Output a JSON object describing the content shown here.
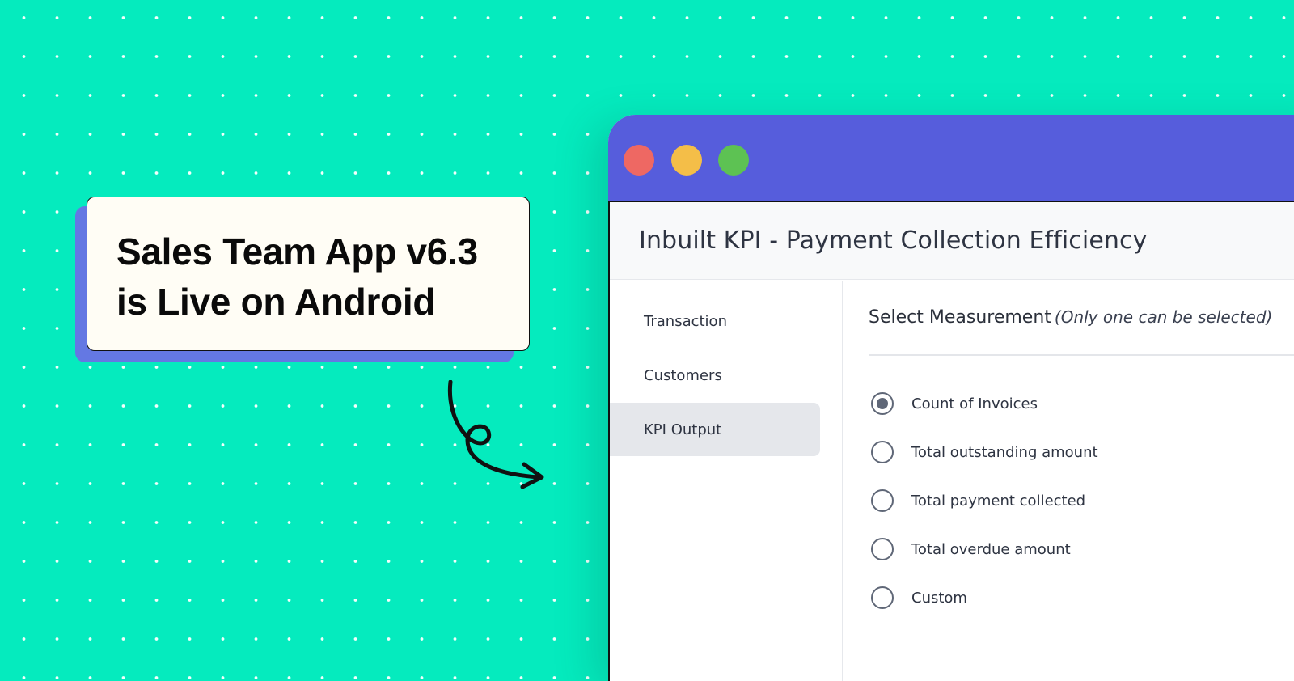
{
  "announcement": {
    "line1": "Sales Team App v6.3",
    "line2": "is Live on Android"
  },
  "window": {
    "controls": [
      "close",
      "minimize",
      "maximize"
    ],
    "title": "Inbuilt KPI - Payment Collection Efficiency"
  },
  "sidebar": {
    "items": [
      {
        "label": "Transaction",
        "active": false
      },
      {
        "label": "Customers",
        "active": false
      },
      {
        "label": "KPI Output",
        "active": true
      }
    ]
  },
  "measurement": {
    "title": "Select Measurement",
    "note": "(Only one can be selected)",
    "options": [
      {
        "label": "Count of Invoices",
        "selected": true
      },
      {
        "label": "Total outstanding amount",
        "selected": false
      },
      {
        "label": "Total payment collected",
        "selected": false
      },
      {
        "label": "Total overdue amount",
        "selected": false
      },
      {
        "label": "Custom",
        "selected": false
      }
    ]
  },
  "colors": {
    "background": "#05EBBE",
    "titlebar": "#565DDC",
    "card_shadow": "#6478E3",
    "card": "#FFFDF5",
    "close": "#EE6863",
    "minimize": "#F4BE48",
    "maximize": "#5DC253"
  }
}
